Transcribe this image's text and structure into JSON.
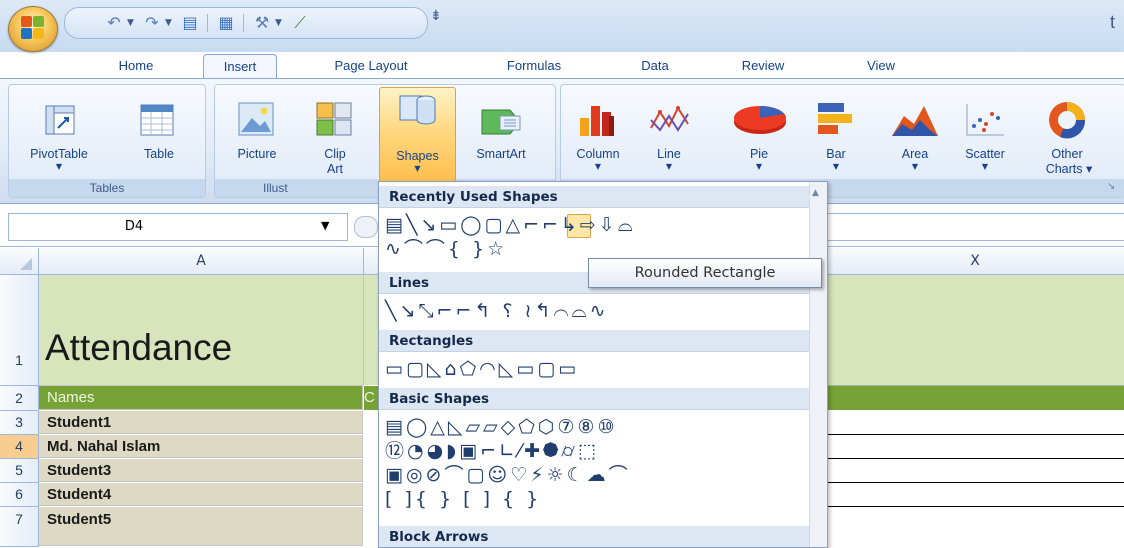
{
  "window": {
    "title_fragment": "t"
  },
  "qat": {
    "icons": [
      "undo-icon",
      "redo-icon",
      "form-icon",
      "document-icon",
      "tools-icon",
      "chart-tool-icon"
    ],
    "more_glyph": "⇟"
  },
  "tabs": [
    "Home",
    "Insert",
    "Page Layout",
    "Formulas",
    "Data",
    "Review",
    "View"
  ],
  "active_tab": "Insert",
  "ribbon": {
    "tables": {
      "pivottable": "PivotTable",
      "table": "Table",
      "group_label": "Tables"
    },
    "illustrations": {
      "picture": "Picture",
      "clipart_line1": "Clip",
      "clipart_line2": "Art",
      "shapes": "Shapes",
      "smartart": "SmartArt",
      "group_label": "Illust"
    },
    "charts": {
      "column": "Column",
      "line": "Line",
      "pie": "Pie",
      "bar": "Bar",
      "area": "Area",
      "scatter": "Scatter",
      "other_line1": "Other",
      "other_line2": "Charts ▾"
    }
  },
  "formula_bar": {
    "name_box": "D4"
  },
  "grid": {
    "col_a": "A",
    "col_x": "X",
    "rows": [
      {
        "num": "1",
        "a": "Attendance"
      },
      {
        "num": "2",
        "a": "Names",
        "b_fragment": "C"
      },
      {
        "num": "3",
        "a": "Student1"
      },
      {
        "num": "4",
        "a": "Md. Nahal Islam"
      },
      {
        "num": "5",
        "a": "Student3"
      },
      {
        "num": "6",
        "a": "Student4"
      },
      {
        "num": "7",
        "a": "Student5"
      }
    ]
  },
  "shapes_gallery": {
    "sections": {
      "recent": "Recently Used Shapes",
      "lines": "Lines",
      "rectangles": "Rectangles",
      "basic": "Basic Shapes",
      "block_arrows": "Block Arrows"
    },
    "recent_row1": "▤╲↘▭◯▢△⌐⌐↳⇨⇩⌓",
    "recent_row2": "∿⌒⌒{ }☆",
    "lines_row": "╲↘⤡⌐⌐↰ ⸮ ≀↰⌒⌓∿",
    "rect_row": "▭▢◺⌂⬠◠◺▭▢▭",
    "basic_row1": "▤◯△◺▱▱◇⬠⬡⑦⑧⑩",
    "basic_row2": "⑫◔◕◗▣⌐∟⁄✚⯄⌭⬚",
    "basic_row3": "▣◎⊘⌒▢☺♡⚡☼☾☁⌒",
    "basic_row4": "[ ]{ } [ ] { }",
    "tooltip": "Rounded Rectangle"
  },
  "colors": {
    "row1_fill": "#d7e4bc",
    "row2_fill": "#76a236",
    "names_fill": "#ddd9c4",
    "selected_row_header": "#f9cc8f"
  }
}
